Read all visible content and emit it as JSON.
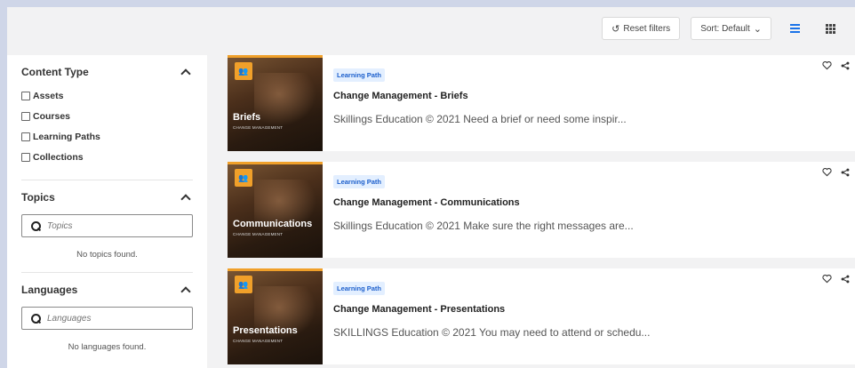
{
  "toolbar": {
    "reset_label": "Reset filters",
    "sort_label": "Sort: Default"
  },
  "filters": {
    "content_type": {
      "title": "Content Type",
      "options": [
        "Assets",
        "Courses",
        "Learning Paths",
        "Collections"
      ]
    },
    "topics": {
      "title": "Topics",
      "placeholder": "Topics",
      "empty": "No topics found."
    },
    "languages": {
      "title": "Languages",
      "placeholder": "Languages",
      "empty": "No languages found."
    }
  },
  "cards": [
    {
      "thumb_title": "Briefs",
      "thumb_sub": "CHANGE MANAGEMENT",
      "tag": "Learning Path",
      "title": "Change Management - Briefs",
      "desc": "Skillings Education © 2021 Need a brief or need some inspir..."
    },
    {
      "thumb_title": "Communications",
      "thumb_sub": "CHANGE MANAGEMENT",
      "tag": "Learning Path",
      "title": "Change Management - Communications",
      "desc": "Skillings Education © 2021 Make sure the right messages are..."
    },
    {
      "thumb_title": "Presentations",
      "thumb_sub": "CHANGE MANAGEMENT",
      "tag": "Learning Path",
      "title": "Change Management - Presentations",
      "desc": "SKILLINGS Education © 2021 You may need to attend or schedu..."
    }
  ],
  "colors": {
    "accent": "#1a73e8",
    "tag_bg": "#e3efff",
    "thumb_badge": "#f0a02a",
    "page_bg": "#cfd6e8"
  }
}
